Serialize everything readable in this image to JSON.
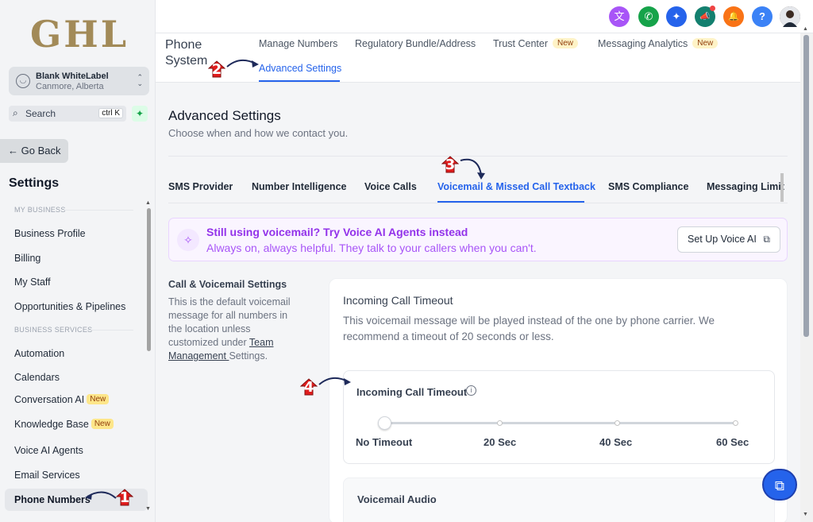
{
  "sidebar": {
    "logo": "GHL",
    "account": {
      "name": "Blank WhiteLabel",
      "location": "Canmore, Alberta",
      "avatar_icon": "user-icon"
    },
    "search": {
      "label": "Search",
      "shortcut": "ctrl K"
    },
    "go_back": "← Go Back",
    "title": "Settings",
    "group_my_business": "MY BUSINESS",
    "group_business_services": "BUSINESS SERVICES",
    "items": [
      {
        "label": "Business Profile"
      },
      {
        "label": "Billing"
      },
      {
        "label": "My Staff"
      },
      {
        "label": "Opportunities & Pipelines"
      },
      {
        "label": "Automation"
      },
      {
        "label": "Calendars"
      },
      {
        "label": "Conversation AI",
        "badge": "New"
      },
      {
        "label": "Knowledge Base",
        "badge": "New"
      },
      {
        "label": "Voice AI Agents"
      },
      {
        "label": "Email Services"
      },
      {
        "label": "Phone Numbers"
      }
    ]
  },
  "topbar": {
    "icons": [
      {
        "name": "translate-icon",
        "glyph": "文",
        "color": "#a855f7"
      },
      {
        "name": "phone-icon",
        "glyph": "✆",
        "color": "#16a34a"
      },
      {
        "name": "magic-wand-icon",
        "glyph": "✦",
        "color": "#2563eb"
      },
      {
        "name": "megaphone-icon",
        "glyph": "📣",
        "color": "#14806f"
      },
      {
        "name": "bell-icon",
        "glyph": "🔔",
        "color": "#f97316"
      },
      {
        "name": "help-icon",
        "glyph": "?",
        "color": "#3b82f6"
      }
    ]
  },
  "subnav": {
    "title": "Phone System",
    "tabs": [
      {
        "label": "Manage Numbers"
      },
      {
        "label": "Regulatory Bundle/Address"
      },
      {
        "label": "Trust Center",
        "badge": "New"
      },
      {
        "label": "Messaging Analytics",
        "badge": "New"
      },
      {
        "label": "Advanced Settings"
      }
    ]
  },
  "main": {
    "title": "Advanced Settings",
    "subtitle": "Choose when and how we contact you.",
    "tabs": [
      {
        "label": "SMS Provider"
      },
      {
        "label": "Number Intelligence"
      },
      {
        "label": "Voice Calls"
      },
      {
        "label": "Voicemail & Missed Call Textback"
      },
      {
        "label": "SMS Compliance"
      },
      {
        "label": "Messaging Limit"
      }
    ],
    "promo": {
      "title": "Still using voicemail? Try Voice AI Agents instead",
      "subtitle": "Always on, always helpful. They talk to your callers when you can't.",
      "button": "Set Up Voice AI"
    },
    "section": {
      "title": "Call & Voicemail Settings",
      "desc_before": "This is the default voicemail message for all numbers in the location unless customized under ",
      "desc_link": "Team Management ",
      "desc_after": "Settings."
    },
    "card": {
      "title": "Incoming Call Timeout",
      "desc": "This voicemail message will be played instead of the one by phone carrier. We recommend a timeout of 20 seconds or less.",
      "field_label": "Incoming Call Timeout",
      "slider_options": [
        "No Timeout",
        "20 Sec",
        "40 Sec",
        "60 Sec"
      ],
      "slider_value": "No Timeout",
      "voicemail_label": "Voicemail Audio"
    }
  },
  "annotations": [
    "1",
    "2",
    "3",
    "4"
  ],
  "colors": {
    "accent": "#2563eb",
    "marker": "#e11d1d",
    "arrow": "#1e2a5a"
  }
}
